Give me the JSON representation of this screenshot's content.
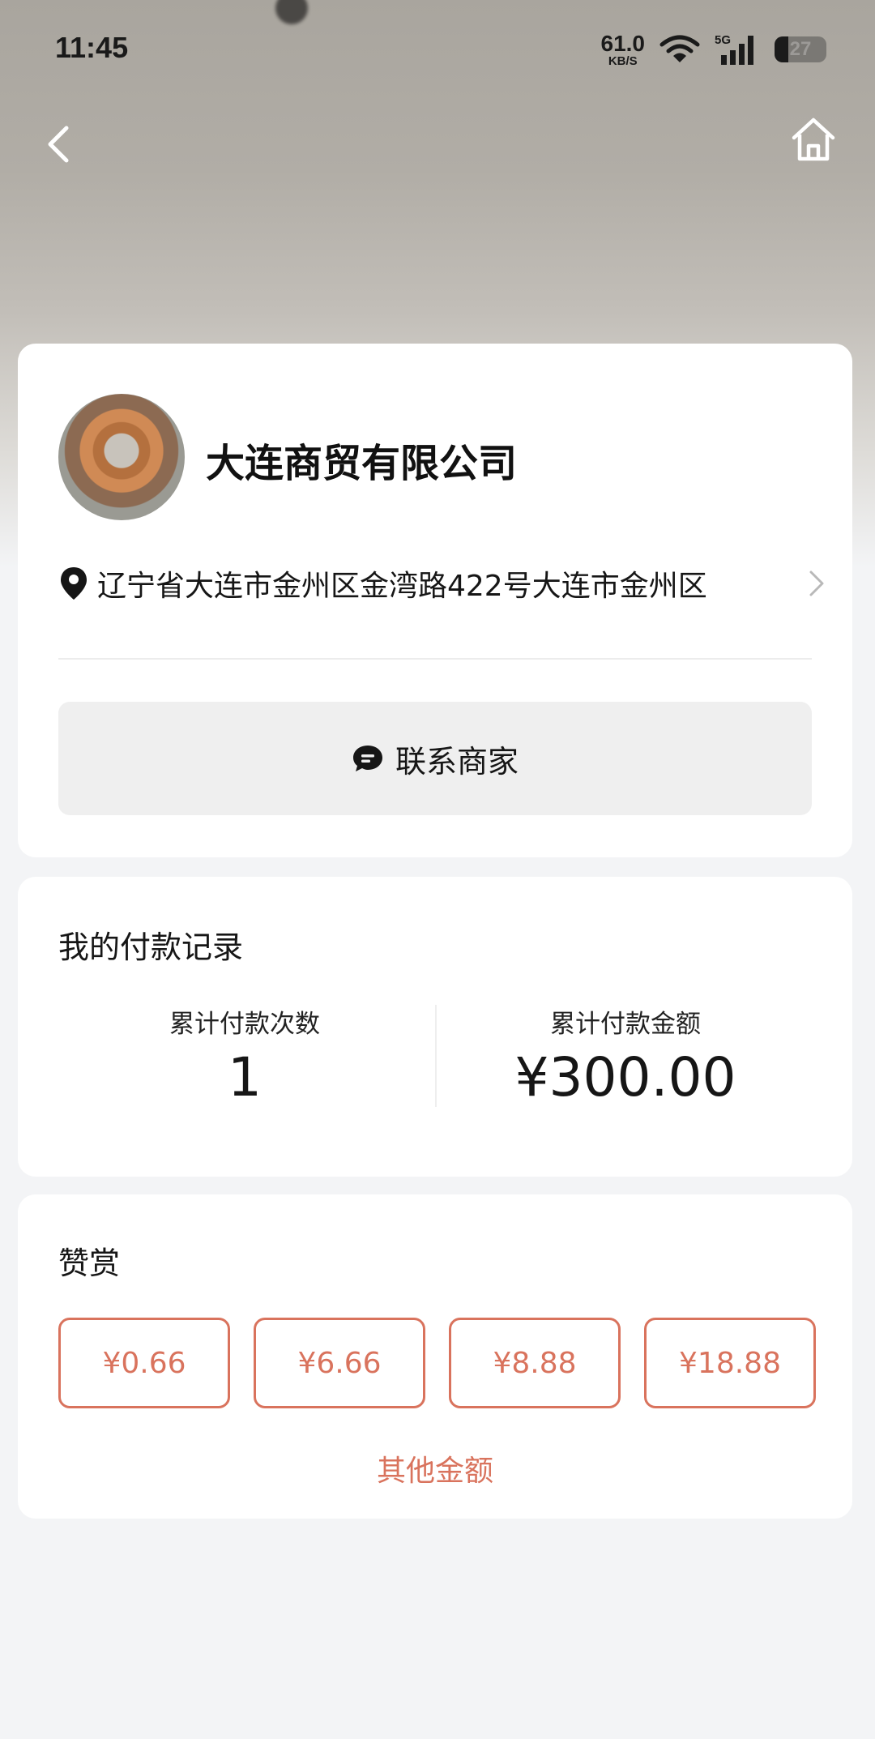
{
  "status_bar": {
    "time": "11:45",
    "net_speed_value": "61.0",
    "net_speed_unit": "KB/S",
    "network_type": "5G",
    "battery_level": "27"
  },
  "nav": {
    "back_icon": "chevron-left-icon",
    "home_icon": "home-icon"
  },
  "merchant": {
    "name": "大连商贸有限公司",
    "address": "辽宁省大连市金州区金湾路422号大连市金州区",
    "contact_label": "联系商家"
  },
  "records": {
    "title": "我的付款记录",
    "count_label": "累计付款次数",
    "count_value": "1",
    "total_label": "累计付款金额",
    "total_value": "¥300.00"
  },
  "reward": {
    "title": "赞赏",
    "amounts": [
      "¥0.66",
      "¥6.66",
      "¥8.88",
      "¥18.88"
    ],
    "other_label": "其他金额"
  },
  "colors": {
    "accent": "#d9735d",
    "card_bg": "#ffffff",
    "page_bg": "#f3f4f6",
    "button_bg": "#efefef"
  }
}
